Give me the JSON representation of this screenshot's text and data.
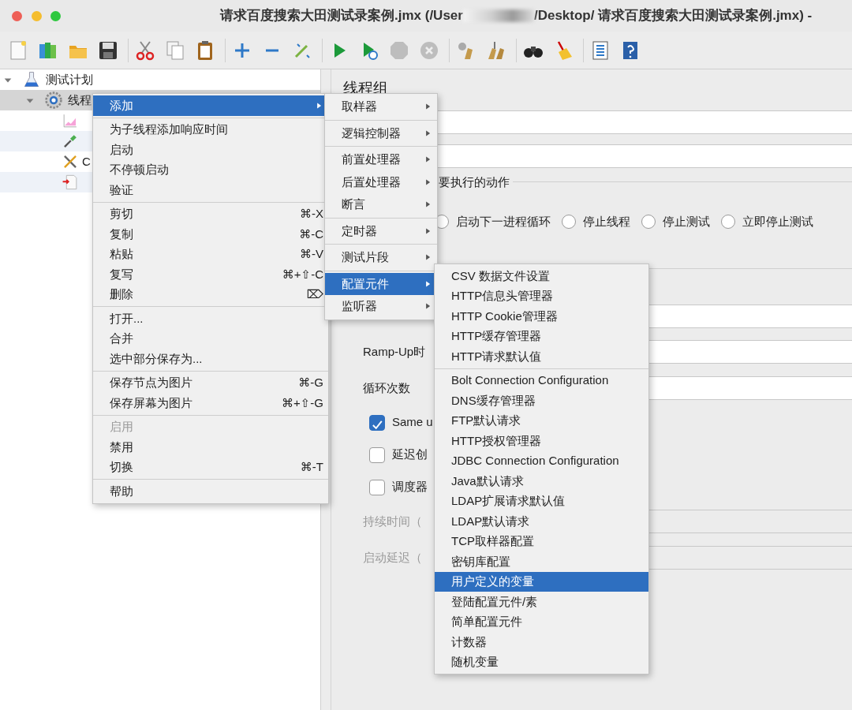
{
  "window": {
    "title": "请求百度搜索大田测试录案例.jmx (/User",
    "title_rest": "/Desktop/ 请求百度搜索大田测试录案例.jmx) -"
  },
  "tree": [
    {
      "label": "测试计划",
      "expanded": true,
      "selected": false,
      "children": [
        {
          "label": "线程",
          "expanded": true,
          "selected": true,
          "children": [
            {
              "selected": false
            },
            {
              "selected": false
            },
            {
              "label": "C",
              "selected": false
            },
            {
              "selected": false
            }
          ]
        }
      ]
    }
  ],
  "context_menu": {
    "sections": [
      [
        {
          "label": "添加",
          "submenu": true,
          "selected": true,
          "disabled": false
        }
      ],
      [
        {
          "label": "为子线程添加响应时间",
          "submenu": false,
          "selected": false,
          "disabled": false
        },
        {
          "label": "启动",
          "submenu": false,
          "selected": false,
          "disabled": false
        },
        {
          "label": "不停顿启动",
          "submenu": false,
          "selected": false,
          "disabled": false
        },
        {
          "label": "验证",
          "submenu": false,
          "selected": false,
          "disabled": false
        }
      ],
      [
        {
          "label": "剪切",
          "shortcut": "⌘-X",
          "submenu": false,
          "selected": false,
          "disabled": false
        },
        {
          "label": "复制",
          "shortcut": "⌘-C",
          "submenu": false,
          "selected": false,
          "disabled": false
        },
        {
          "label": "粘贴",
          "shortcut": "⌘-V",
          "submenu": false,
          "selected": false,
          "disabled": false
        },
        {
          "label": "复写",
          "shortcut": "⌘+⇧-C",
          "submenu": false,
          "selected": false,
          "disabled": false
        },
        {
          "label": "删除",
          "shortcut": "⌦",
          "submenu": false,
          "selected": false,
          "disabled": false
        }
      ],
      [
        {
          "label": "打开...",
          "submenu": false,
          "selected": false,
          "disabled": false
        },
        {
          "label": "合并",
          "submenu": false,
          "selected": false,
          "disabled": false
        },
        {
          "label": "选中部分保存为...",
          "submenu": false,
          "selected": false,
          "disabled": false
        }
      ],
      [
        {
          "label": "保存节点为图片",
          "shortcut": "⌘-G",
          "submenu": false,
          "selected": false,
          "disabled": false
        },
        {
          "label": "保存屏幕为图片",
          "shortcut": "⌘+⇧-G",
          "submenu": false,
          "selected": false,
          "disabled": false
        }
      ],
      [
        {
          "label": "启用",
          "submenu": false,
          "selected": false,
          "disabled": true
        },
        {
          "label": "禁用",
          "submenu": false,
          "selected": false,
          "disabled": false
        },
        {
          "label": "切换",
          "shortcut": "⌘-T",
          "submenu": false,
          "selected": false,
          "disabled": false
        }
      ],
      [
        {
          "label": "帮助",
          "submenu": false,
          "selected": false,
          "disabled": false
        }
      ]
    ]
  },
  "add_submenu": {
    "sections": [
      [
        {
          "label": "取样器",
          "submenu": true,
          "selected": false,
          "disabled": false
        }
      ],
      [
        {
          "label": "逻辑控制器",
          "submenu": true,
          "selected": false,
          "disabled": false
        }
      ],
      [
        {
          "label": "前置处理器",
          "submenu": true,
          "selected": false,
          "disabled": false
        },
        {
          "label": "后置处理器",
          "submenu": true,
          "selected": false,
          "disabled": false
        },
        {
          "label": "断言",
          "submenu": true,
          "selected": false,
          "disabled": false
        }
      ],
      [
        {
          "label": "定时器",
          "submenu": true,
          "selected": false,
          "disabled": false
        }
      ],
      [
        {
          "label": "测试片段",
          "submenu": true,
          "selected": false,
          "disabled": false
        }
      ],
      [
        {
          "label": "配置元件",
          "submenu": true,
          "selected": true,
          "disabled": false
        },
        {
          "label": "监听器",
          "submenu": true,
          "selected": false,
          "disabled": false
        }
      ]
    ]
  },
  "config_submenu": {
    "sections": [
      [
        {
          "label": "CSV 数据文件设置",
          "submenu": false,
          "selected": false,
          "disabled": false
        },
        {
          "label": "HTTP信息头管理器",
          "submenu": false,
          "selected": false,
          "disabled": false
        },
        {
          "label": "HTTP Cookie管理器",
          "submenu": false,
          "selected": false,
          "disabled": false
        },
        {
          "label": "HTTP缓存管理器",
          "submenu": false,
          "selected": false,
          "disabled": false
        },
        {
          "label": "HTTP请求默认值",
          "submenu": false,
          "selected": false,
          "disabled": false
        }
      ],
      [
        {
          "label": "Bolt Connection Configuration",
          "submenu": false,
          "selected": false,
          "disabled": false
        },
        {
          "label": "DNS缓存管理器",
          "submenu": false,
          "selected": false,
          "disabled": false
        },
        {
          "label": "FTP默认请求",
          "submenu": false,
          "selected": false,
          "disabled": false
        },
        {
          "label": "HTTP授权管理器",
          "submenu": false,
          "selected": false,
          "disabled": false
        },
        {
          "label": "JDBC Connection Configuration",
          "submenu": false,
          "selected": false,
          "disabled": false
        },
        {
          "label": "Java默认请求",
          "submenu": false,
          "selected": false,
          "disabled": false
        },
        {
          "label": "LDAP扩展请求默认值",
          "submenu": false,
          "selected": false,
          "disabled": false
        },
        {
          "label": "LDAP默认请求",
          "submenu": false,
          "selected": false,
          "disabled": false
        },
        {
          "label": "TCP取样器配置",
          "submenu": false,
          "selected": false,
          "disabled": false
        },
        {
          "label": "密钥库配置",
          "submenu": false,
          "selected": false,
          "disabled": false
        },
        {
          "label": "用户定义的变量",
          "submenu": false,
          "selected": true,
          "disabled": false
        },
        {
          "label": "登陆配置元件/素",
          "submenu": false,
          "selected": false,
          "disabled": false
        },
        {
          "label": "简单配置元件",
          "submenu": false,
          "selected": false,
          "disabled": false
        },
        {
          "label": "计数器",
          "submenu": false,
          "selected": false,
          "disabled": false
        },
        {
          "label": "随机变量",
          "submenu": false,
          "selected": false,
          "disabled": false
        }
      ]
    ]
  },
  "panel": {
    "title": "线程组",
    "error_action": {
      "legend": "要执行的动作",
      "options": [
        {
          "label": "启动下一进程循环",
          "selected": false
        },
        {
          "label": "停止线程",
          "selected": false
        },
        {
          "label": "停止测试",
          "selected": false
        },
        {
          "label": "立即停止测试",
          "selected": false
        }
      ]
    },
    "thread_properties": [
      {
        "kind": "field",
        "disabled": false
      },
      {
        "kind": "field",
        "label": "Ramp-Up时",
        "disabled": false
      },
      {
        "kind": "field",
        "label": "循环次数",
        "disabled": false
      },
      {
        "kind": "checkbox",
        "label": "Same u",
        "checked": true
      },
      {
        "kind": "checkbox",
        "label": "延迟创",
        "checked": false
      },
      {
        "kind": "checkbox",
        "label": "调度器",
        "checked": false
      },
      {
        "kind": "field",
        "label": "持续时间（",
        "disabled": true
      },
      {
        "kind": "field",
        "label": "启动延迟（",
        "disabled": true
      }
    ]
  }
}
